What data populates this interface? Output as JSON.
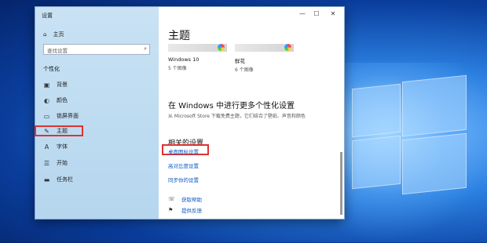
{
  "window": {
    "title": "设置"
  },
  "titlebar": {
    "minimize": "—",
    "maximize": "☐",
    "close": "✕"
  },
  "sidebar": {
    "home": {
      "icon": "⌂",
      "label": "主页"
    },
    "search": {
      "placeholder": "查找设置",
      "icon": "⌕"
    },
    "section": "个性化",
    "items": [
      {
        "icon": "▣",
        "label": "背景"
      },
      {
        "icon": "◐",
        "label": "颜色"
      },
      {
        "icon": "▭",
        "label": "锁屏界面"
      },
      {
        "icon": "✎",
        "label": "主题"
      },
      {
        "icon": "A",
        "label": "字体"
      },
      {
        "icon": "☰",
        "label": "开始"
      },
      {
        "icon": "▬",
        "label": "任务栏"
      }
    ]
  },
  "content": {
    "title": "主题",
    "themes": [
      {
        "name": "Windows 10",
        "count": "5 个图像"
      },
      {
        "name": "鲜花",
        "count": "6 个图像"
      }
    ],
    "store_title": "在 Windows 中进行更多个性化设置",
    "store_desc": "从 Microsoft Store 下载免费主题，它们结合了壁纸、声音和颜色",
    "related_title": "相关的设置",
    "related_links": [
      "桌面图标设置",
      "高对比度设置",
      "同步你的设置"
    ],
    "help": [
      {
        "icon": "☏",
        "label": "获取帮助"
      },
      {
        "icon": "⚑",
        "label": "提供反馈"
      }
    ]
  },
  "colors": {
    "highlight": "#dd3333",
    "link": "#0a5bc4"
  }
}
